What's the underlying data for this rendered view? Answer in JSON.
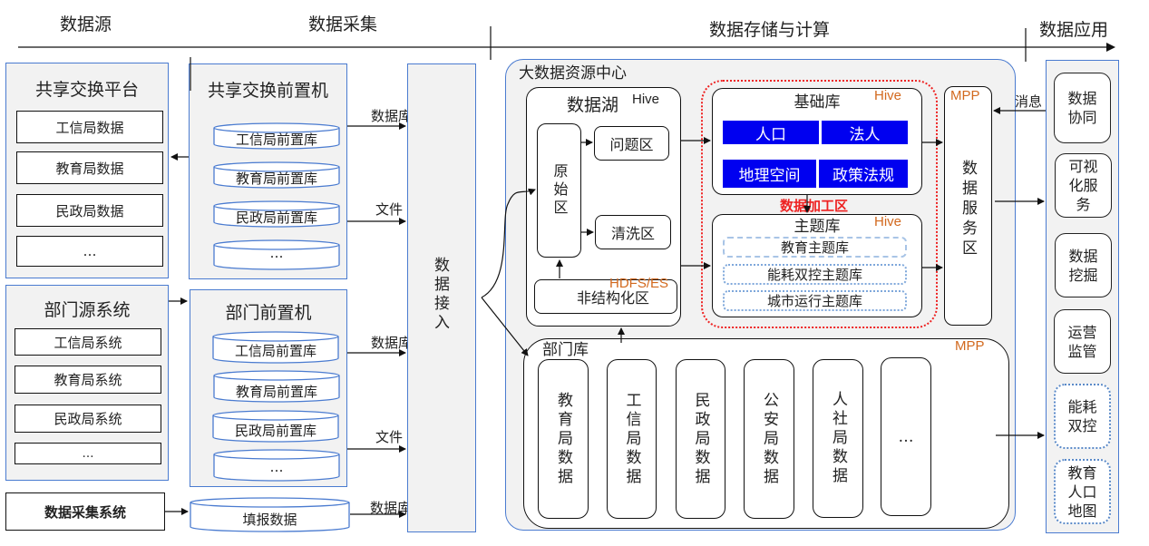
{
  "stages": {
    "source": "数据源",
    "collect": "数据采集",
    "storage": "数据存储与计算",
    "application": "数据应用"
  },
  "source": {
    "share_platform": {
      "title": "共享交换平台",
      "items": [
        "工信局数据",
        "教育局数据",
        "民政局数据",
        "…"
      ]
    },
    "dept_system": {
      "title": "部门源系统",
      "items": [
        "工信局系统",
        "教育局系统",
        "民政局系统",
        "…"
      ]
    },
    "collect_system": "数据采集系统"
  },
  "collect": {
    "share_frontend": {
      "title": "共享交换前置机",
      "dbs": [
        "工信局前置库",
        "教育局前置库",
        "民政局前置库",
        "…"
      ]
    },
    "dept_frontend": {
      "title": "部门前置机",
      "dbs": [
        "工信局前置库",
        "教育局前置库",
        "民政局前置库",
        "…"
      ]
    },
    "fill_data": "填报数据",
    "edge_labels": {
      "db": "数据库",
      "file": "文件"
    },
    "access": "数据接入"
  },
  "center": {
    "title": "大数据资源中心",
    "data_lake": {
      "title": "数据湖",
      "engine": "Hive",
      "raw_zone": "原始区",
      "problem_zone": "问题区",
      "clean_zone": "清洗区",
      "unstructured_zone": "非结构化区",
      "unstructured_engine": "HDFS/ES"
    },
    "processing_zone_label": "数据加工区",
    "base_db": {
      "title": "基础库",
      "engine": "Hive",
      "tiles": [
        "人口",
        "法人",
        "地理空间",
        "政策法规"
      ]
    },
    "theme_db": {
      "title": "主题库",
      "engine": "Hive",
      "items": [
        "教育主题库",
        "能耗双控主题库",
        "城市运行主题库"
      ]
    },
    "service_zone": {
      "engine": "MPP",
      "title": "数据服务区"
    },
    "dept_db": {
      "title": "部门库",
      "engine": "MPP",
      "columns": [
        "教育局数据",
        "工信局数据",
        "民政局数据",
        "公安局数据",
        "人社局数据",
        "…"
      ]
    }
  },
  "application": {
    "message_label": "消息",
    "items": [
      "数据协同",
      "可视化服务",
      "数据挖掘",
      "运营监管",
      "能耗双控",
      "教育人口地图"
    ],
    "dotted_items": [
      4,
      5
    ]
  },
  "colors": {
    "panel_border": "#4a7bd0",
    "panel_fill": "#f2f2f2",
    "tile_blue": "#0000f0",
    "engine_orange": "#d2691e",
    "processing_red": "#ee2222",
    "dotted_blue": "#5b8ac8"
  }
}
